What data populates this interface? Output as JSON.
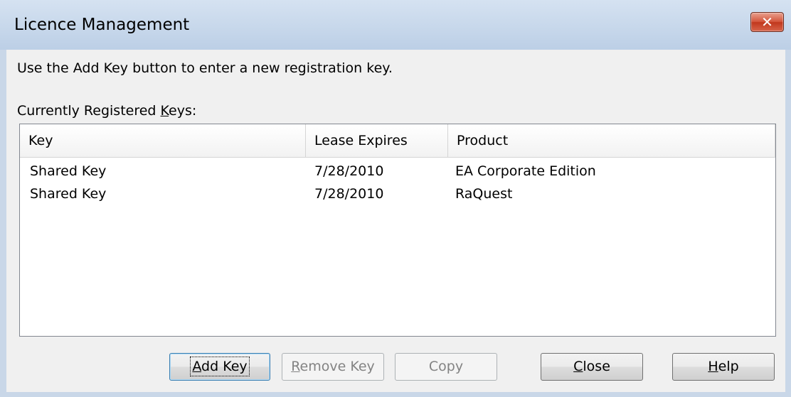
{
  "window": {
    "title": "Licence Management",
    "close_glyph": "✕"
  },
  "instruction": "Use the Add Key button to enter a new registration key.",
  "list_label": {
    "before": "Currently Registered ",
    "mnemonic": "K",
    "after": "eys:"
  },
  "table": {
    "columns": [
      "Key",
      "Lease Expires",
      "Product"
    ],
    "rows": [
      [
        "Shared Key",
        "7/28/2010",
        "EA Corporate Edition"
      ],
      [
        "Shared Key",
        "7/28/2010",
        "RaQuest"
      ]
    ]
  },
  "buttons": {
    "add_key": {
      "mnemonic": "A",
      "rest": "dd Key",
      "enabled": true
    },
    "remove_key": {
      "mnemonic": "R",
      "rest": "emove Key",
      "enabled": false
    },
    "copy": {
      "label": "Copy",
      "enabled": false
    },
    "close": {
      "mnemonic": "C",
      "rest": "lose",
      "enabled": true
    },
    "help": {
      "mnemonic": "H",
      "rest": "elp",
      "enabled": true
    }
  },
  "colors": {
    "titlebar": "#c9d7e8",
    "client": "#f0f0f0",
    "close_button": "#c7412a"
  }
}
